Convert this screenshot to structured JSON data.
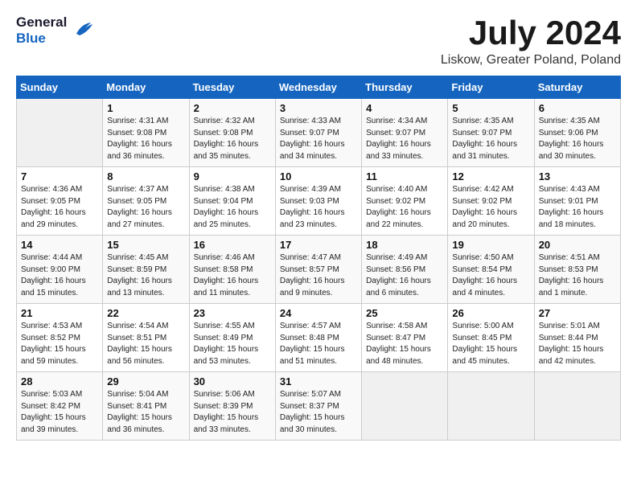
{
  "logo": {
    "general": "General",
    "blue": "Blue",
    "bird_symbol": "▶"
  },
  "title": {
    "month_year": "July 2024",
    "location": "Liskow, Greater Poland, Poland"
  },
  "calendar": {
    "headers": [
      "Sunday",
      "Monday",
      "Tuesday",
      "Wednesday",
      "Thursday",
      "Friday",
      "Saturday"
    ],
    "weeks": [
      [
        {
          "day": "",
          "text": ""
        },
        {
          "day": "1",
          "text": "Sunrise: 4:31 AM\nSunset: 9:08 PM\nDaylight: 16 hours\nand 36 minutes."
        },
        {
          "day": "2",
          "text": "Sunrise: 4:32 AM\nSunset: 9:08 PM\nDaylight: 16 hours\nand 35 minutes."
        },
        {
          "day": "3",
          "text": "Sunrise: 4:33 AM\nSunset: 9:07 PM\nDaylight: 16 hours\nand 34 minutes."
        },
        {
          "day": "4",
          "text": "Sunrise: 4:34 AM\nSunset: 9:07 PM\nDaylight: 16 hours\nand 33 minutes."
        },
        {
          "day": "5",
          "text": "Sunrise: 4:35 AM\nSunset: 9:07 PM\nDaylight: 16 hours\nand 31 minutes."
        },
        {
          "day": "6",
          "text": "Sunrise: 4:35 AM\nSunset: 9:06 PM\nDaylight: 16 hours\nand 30 minutes."
        }
      ],
      [
        {
          "day": "7",
          "text": "Sunrise: 4:36 AM\nSunset: 9:05 PM\nDaylight: 16 hours\nand 29 minutes."
        },
        {
          "day": "8",
          "text": "Sunrise: 4:37 AM\nSunset: 9:05 PM\nDaylight: 16 hours\nand 27 minutes."
        },
        {
          "day": "9",
          "text": "Sunrise: 4:38 AM\nSunset: 9:04 PM\nDaylight: 16 hours\nand 25 minutes."
        },
        {
          "day": "10",
          "text": "Sunrise: 4:39 AM\nSunset: 9:03 PM\nDaylight: 16 hours\nand 23 minutes."
        },
        {
          "day": "11",
          "text": "Sunrise: 4:40 AM\nSunset: 9:02 PM\nDaylight: 16 hours\nand 22 minutes."
        },
        {
          "day": "12",
          "text": "Sunrise: 4:42 AM\nSunset: 9:02 PM\nDaylight: 16 hours\nand 20 minutes."
        },
        {
          "day": "13",
          "text": "Sunrise: 4:43 AM\nSunset: 9:01 PM\nDaylight: 16 hours\nand 18 minutes."
        }
      ],
      [
        {
          "day": "14",
          "text": "Sunrise: 4:44 AM\nSunset: 9:00 PM\nDaylight: 16 hours\nand 15 minutes."
        },
        {
          "day": "15",
          "text": "Sunrise: 4:45 AM\nSunset: 8:59 PM\nDaylight: 16 hours\nand 13 minutes."
        },
        {
          "day": "16",
          "text": "Sunrise: 4:46 AM\nSunset: 8:58 PM\nDaylight: 16 hours\nand 11 minutes."
        },
        {
          "day": "17",
          "text": "Sunrise: 4:47 AM\nSunset: 8:57 PM\nDaylight: 16 hours\nand 9 minutes."
        },
        {
          "day": "18",
          "text": "Sunrise: 4:49 AM\nSunset: 8:56 PM\nDaylight: 16 hours\nand 6 minutes."
        },
        {
          "day": "19",
          "text": "Sunrise: 4:50 AM\nSunset: 8:54 PM\nDaylight: 16 hours\nand 4 minutes."
        },
        {
          "day": "20",
          "text": "Sunrise: 4:51 AM\nSunset: 8:53 PM\nDaylight: 16 hours\nand 1 minute."
        }
      ],
      [
        {
          "day": "21",
          "text": "Sunrise: 4:53 AM\nSunset: 8:52 PM\nDaylight: 15 hours\nand 59 minutes."
        },
        {
          "day": "22",
          "text": "Sunrise: 4:54 AM\nSunset: 8:51 PM\nDaylight: 15 hours\nand 56 minutes."
        },
        {
          "day": "23",
          "text": "Sunrise: 4:55 AM\nSunset: 8:49 PM\nDaylight: 15 hours\nand 53 minutes."
        },
        {
          "day": "24",
          "text": "Sunrise: 4:57 AM\nSunset: 8:48 PM\nDaylight: 15 hours\nand 51 minutes."
        },
        {
          "day": "25",
          "text": "Sunrise: 4:58 AM\nSunset: 8:47 PM\nDaylight: 15 hours\nand 48 minutes."
        },
        {
          "day": "26",
          "text": "Sunrise: 5:00 AM\nSunset: 8:45 PM\nDaylight: 15 hours\nand 45 minutes."
        },
        {
          "day": "27",
          "text": "Sunrise: 5:01 AM\nSunset: 8:44 PM\nDaylight: 15 hours\nand 42 minutes."
        }
      ],
      [
        {
          "day": "28",
          "text": "Sunrise: 5:03 AM\nSunset: 8:42 PM\nDaylight: 15 hours\nand 39 minutes."
        },
        {
          "day": "29",
          "text": "Sunrise: 5:04 AM\nSunset: 8:41 PM\nDaylight: 15 hours\nand 36 minutes."
        },
        {
          "day": "30",
          "text": "Sunrise: 5:06 AM\nSunset: 8:39 PM\nDaylight: 15 hours\nand 33 minutes."
        },
        {
          "day": "31",
          "text": "Sunrise: 5:07 AM\nSunset: 8:37 PM\nDaylight: 15 hours\nand 30 minutes."
        },
        {
          "day": "",
          "text": ""
        },
        {
          "day": "",
          "text": ""
        },
        {
          "day": "",
          "text": ""
        }
      ]
    ]
  }
}
